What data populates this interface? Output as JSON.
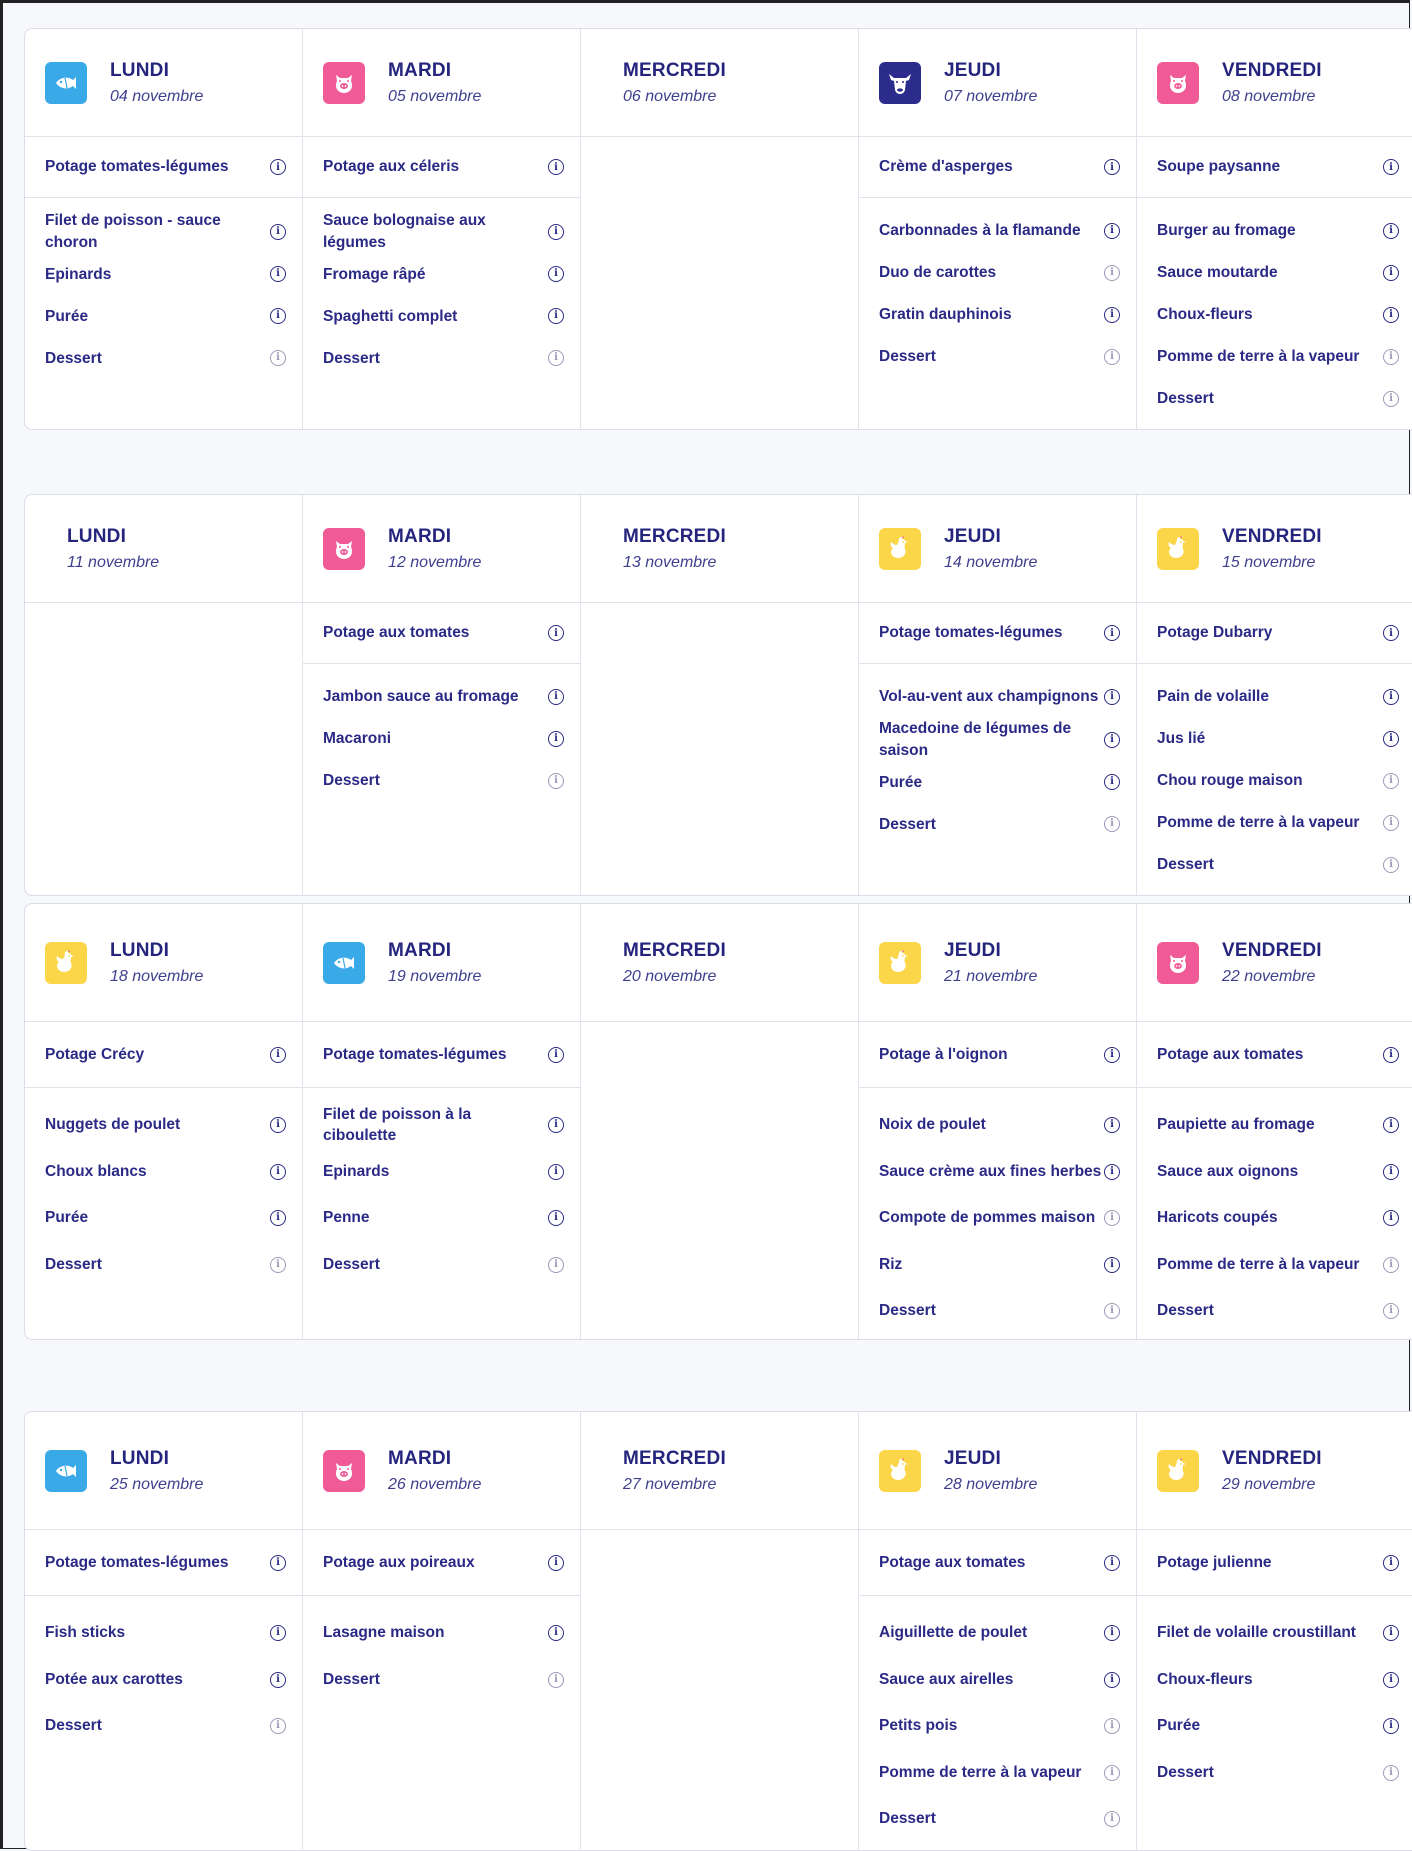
{
  "weeks": [
    {
      "days": [
        {
          "name": "LUNDI",
          "date": "04 novembre",
          "icon": "fish",
          "soup": "Potage tomates-légumes",
          "items": [
            "Filet de poisson - sauce choron",
            "Epinards",
            "Purée",
            "Dessert"
          ]
        },
        {
          "name": "MARDI",
          "date": "05 novembre",
          "icon": "pig",
          "soup": "Potage aux céleris",
          "items": [
            "Sauce bolognaise aux légumes",
            "Fromage râpé",
            "Spaghetti complet",
            "Dessert"
          ]
        },
        {
          "name": "MERCREDI",
          "date": "06 novembre",
          "icon": "",
          "soup": "",
          "items": []
        },
        {
          "name": "JEUDI",
          "date": "07 novembre",
          "icon": "beef",
          "soup": "Crème d'asperges",
          "items": [
            "Carbonnades à la flamande",
            "Duo de carottes",
            "Gratin dauphinois",
            "Dessert"
          ]
        },
        {
          "name": "VENDREDI",
          "date": "08 novembre",
          "icon": "pig",
          "soup": "Soupe paysanne",
          "items": [
            "Burger au fromage",
            "Sauce moutarde",
            "Choux-fleurs",
            "Pomme de terre à la vapeur",
            "Dessert"
          ]
        }
      ]
    },
    {
      "days": [
        {
          "name": "LUNDI",
          "date": "11 novembre",
          "icon": "",
          "soup": "",
          "items": []
        },
        {
          "name": "MARDI",
          "date": "12 novembre",
          "icon": "pig",
          "soup": "Potage aux tomates",
          "items": [
            "Jambon sauce au fromage",
            "Macaroni",
            "Dessert"
          ]
        },
        {
          "name": "MERCREDI",
          "date": "13 novembre",
          "icon": "",
          "soup": "",
          "items": []
        },
        {
          "name": "JEUDI",
          "date": "14 novembre",
          "icon": "chicken",
          "soup": "Potage tomates-légumes",
          "items": [
            "Vol-au-vent aux champignons",
            "Macedoine de légumes de saison",
            "Purée",
            "Dessert"
          ]
        },
        {
          "name": "VENDREDI",
          "date": "15 novembre",
          "icon": "chicken",
          "soup": "Potage Dubarry",
          "items": [
            "Pain de volaille",
            "Jus lié",
            "Chou rouge maison",
            "Pomme de terre à la vapeur",
            "Dessert"
          ]
        }
      ]
    },
    {
      "days": [
        {
          "name": "LUNDI",
          "date": "18 novembre",
          "icon": "chicken",
          "soup": "Potage Crécy",
          "items": [
            "Nuggets de poulet",
            "Choux blancs",
            "Purée",
            "Dessert"
          ]
        },
        {
          "name": "MARDI",
          "date": "19 novembre",
          "icon": "fish",
          "soup": "Potage tomates-légumes",
          "items": [
            "Filet de poisson à la ciboulette",
            "Epinards",
            "Penne",
            "Dessert"
          ]
        },
        {
          "name": "MERCREDI",
          "date": "20 novembre",
          "icon": "",
          "soup": "",
          "items": []
        },
        {
          "name": "JEUDI",
          "date": "21 novembre",
          "icon": "chicken",
          "soup": "Potage à l'oignon",
          "items": [
            "Noix de poulet",
            "Sauce crème aux fines herbes",
            "Compote de pommes maison",
            "Riz",
            "Dessert"
          ]
        },
        {
          "name": "VENDREDI",
          "date": "22 novembre",
          "icon": "pig",
          "soup": "Potage aux tomates",
          "items": [
            "Paupiette au fromage",
            "Sauce aux oignons",
            "Haricots coupés",
            "Pomme de terre à la vapeur",
            "Dessert"
          ]
        }
      ]
    },
    {
      "days": [
        {
          "name": "LUNDI",
          "date": "25 novembre",
          "icon": "fish",
          "soup": "Potage tomates-légumes",
          "items": [
            "Fish sticks",
            "Potée aux carottes",
            "Dessert"
          ]
        },
        {
          "name": "MARDI",
          "date": "26 novembre",
          "icon": "pig",
          "soup": "Potage aux poireaux",
          "items": [
            "Lasagne maison",
            "Dessert"
          ]
        },
        {
          "name": "MERCREDI",
          "date": "27 novembre",
          "icon": "",
          "soup": "",
          "items": []
        },
        {
          "name": "JEUDI",
          "date": "28 novembre",
          "icon": "chicken",
          "soup": "Potage aux tomates",
          "items": [
            "Aiguillette de poulet",
            "Sauce aux airelles",
            "Petits pois",
            "Pomme de terre à la vapeur",
            "Dessert"
          ]
        },
        {
          "name": "VENDREDI",
          "date": "29 novembre",
          "icon": "chicken",
          "soup": "Potage julienne",
          "items": [
            "Filet de volaille croustillant",
            "Choux-fleurs",
            "Purée",
            "Dessert"
          ]
        }
      ]
    }
  ],
  "icon_colors": {
    "fish": "#3aa9e8",
    "pig": "#f05a96",
    "beef": "#2c2c8c",
    "chicken": "#fbd648"
  }
}
